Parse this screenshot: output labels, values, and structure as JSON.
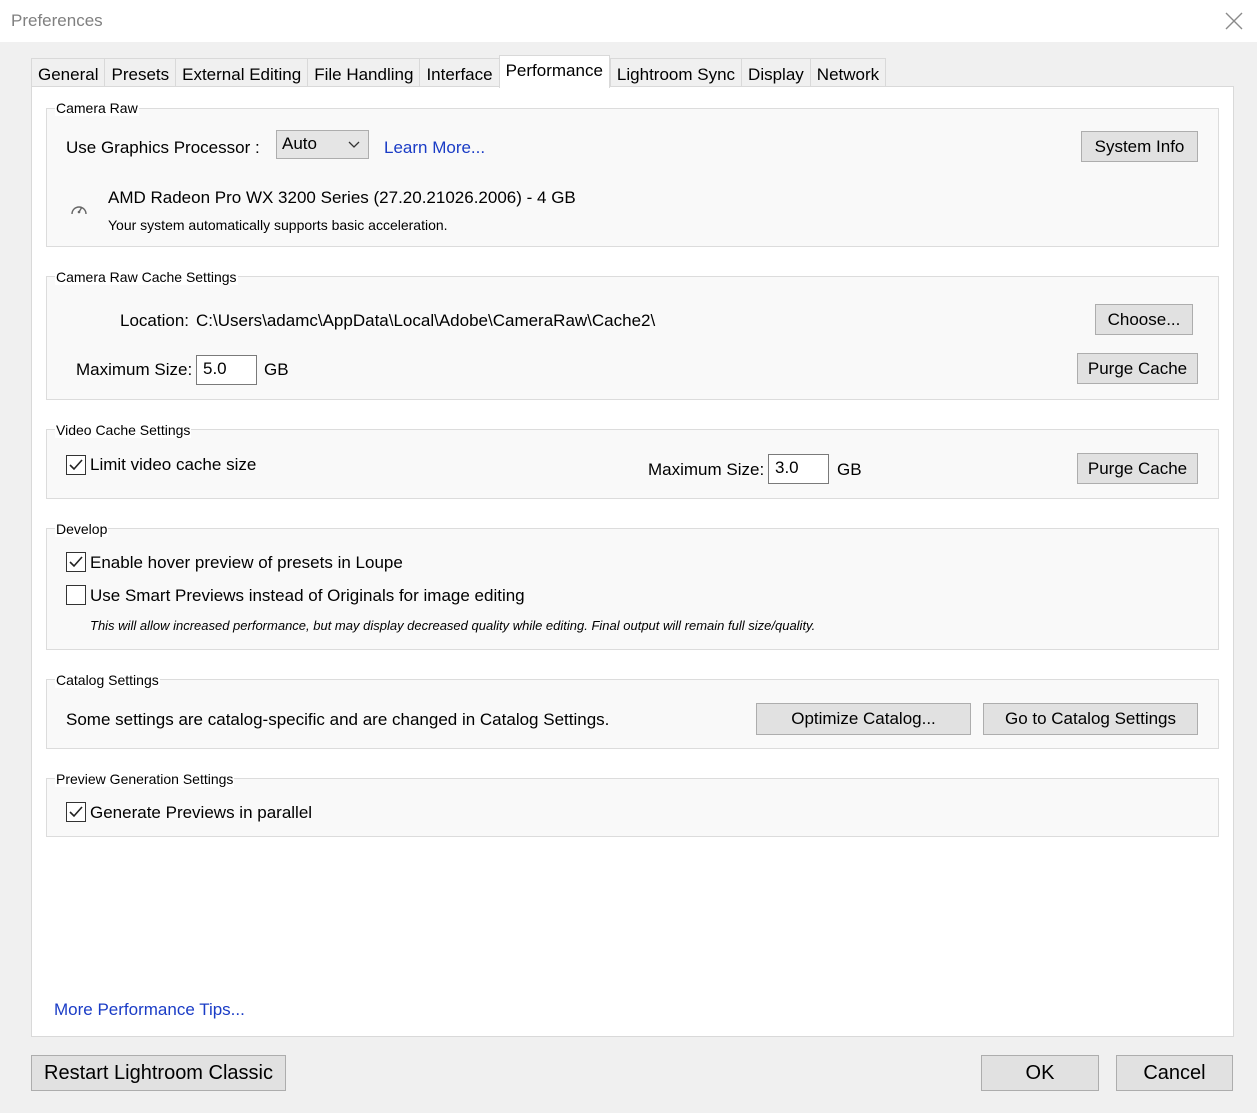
{
  "window": {
    "title": "Preferences"
  },
  "tabs": [
    {
      "label": "General"
    },
    {
      "label": "Presets"
    },
    {
      "label": "External Editing"
    },
    {
      "label": "File Handling"
    },
    {
      "label": "Interface"
    },
    {
      "label": "Performance",
      "active": true
    },
    {
      "label": "Lightroom Sync"
    },
    {
      "label": "Display"
    },
    {
      "label": "Network"
    }
  ],
  "camera_raw": {
    "group_label": "Camera Raw",
    "gpu_label": "Use Graphics Processor :",
    "gpu_value": "Auto",
    "learn_more": "Learn More...",
    "system_info_button": "System Info",
    "gpu_name": "AMD Radeon Pro WX 3200 Series (27.20.21026.2006) - 4 GB",
    "gpu_status": "Your system automatically supports basic acceleration."
  },
  "cache_settings": {
    "group_label": "Camera Raw Cache Settings",
    "location_label": "Location:",
    "location_value": "C:\\Users\\adamc\\AppData\\Local\\Adobe\\CameraRaw\\Cache2\\",
    "choose_button": "Choose...",
    "max_size_label": "Maximum Size:",
    "max_size_value": "5.0",
    "unit": "GB",
    "purge_button": "Purge Cache"
  },
  "video_cache": {
    "group_label": "Video Cache Settings",
    "limit_label": "Limit video cache size",
    "limit_checked": true,
    "max_size_label": "Maximum Size:",
    "max_size_value": "3.0",
    "unit": "GB",
    "purge_button": "Purge Cache"
  },
  "develop": {
    "group_label": "Develop",
    "hover_preview_label": "Enable hover preview of presets in Loupe",
    "hover_preview_checked": true,
    "smart_previews_label": "Use Smart Previews instead of Originals for image editing",
    "smart_previews_checked": false,
    "smart_previews_note": "This will allow increased performance, but may display decreased quality while editing. Final output will remain full size/quality."
  },
  "catalog": {
    "group_label": "Catalog Settings",
    "text": "Some settings are catalog-specific and are changed in Catalog Settings.",
    "optimize_button": "Optimize Catalog...",
    "goto_button": "Go to Catalog Settings"
  },
  "preview_generation": {
    "group_label": "Preview Generation Settings",
    "parallel_label": "Generate Previews in parallel",
    "parallel_checked": true
  },
  "footer": {
    "tips_link": "More Performance Tips...",
    "restart_button": "Restart Lightroom Classic",
    "ok_button": "OK",
    "cancel_button": "Cancel"
  }
}
